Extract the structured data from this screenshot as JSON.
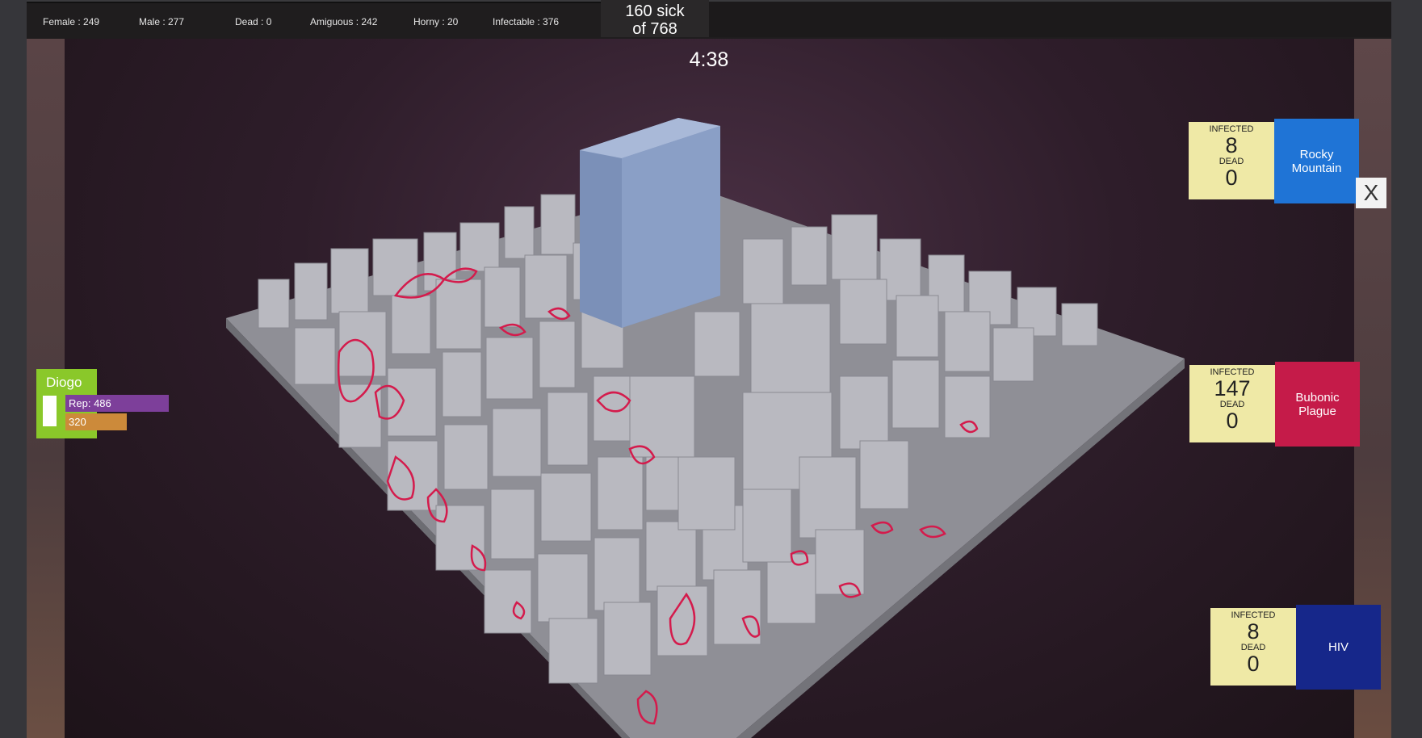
{
  "stats": {
    "female": "Female : 249",
    "male": "Male : 277",
    "dead": "Dead : 0",
    "ambiguous": "Amiguous : 242",
    "horny": "Horny : 20",
    "infectable": "Infectable : 376"
  },
  "sick": {
    "line1": "160 sick",
    "line2": "of 768"
  },
  "timer": "4:38",
  "player": {
    "name": "Diogo",
    "rep": "Rep: 486",
    "money": "320"
  },
  "diseases": [
    {
      "infected_label": "INFECTED",
      "infected": "8",
      "dead_label": "DEAD",
      "dead": "0",
      "name_line1": "Rocky",
      "name_line2": "Mountain",
      "color": "#1f74d6"
    },
    {
      "infected_label": "INFECTED",
      "infected": "147",
      "dead_label": "DEAD",
      "dead": "0",
      "name_line1": "Bubonic",
      "name_line2": "Plague",
      "color": "#c51b49"
    },
    {
      "infected_label": "INFECTED",
      "infected": "8",
      "dead_label": "DEAD",
      "dead": "0",
      "name_line1": "HIV",
      "name_line2": "",
      "color": "#16278a"
    }
  ],
  "close_label": "X"
}
